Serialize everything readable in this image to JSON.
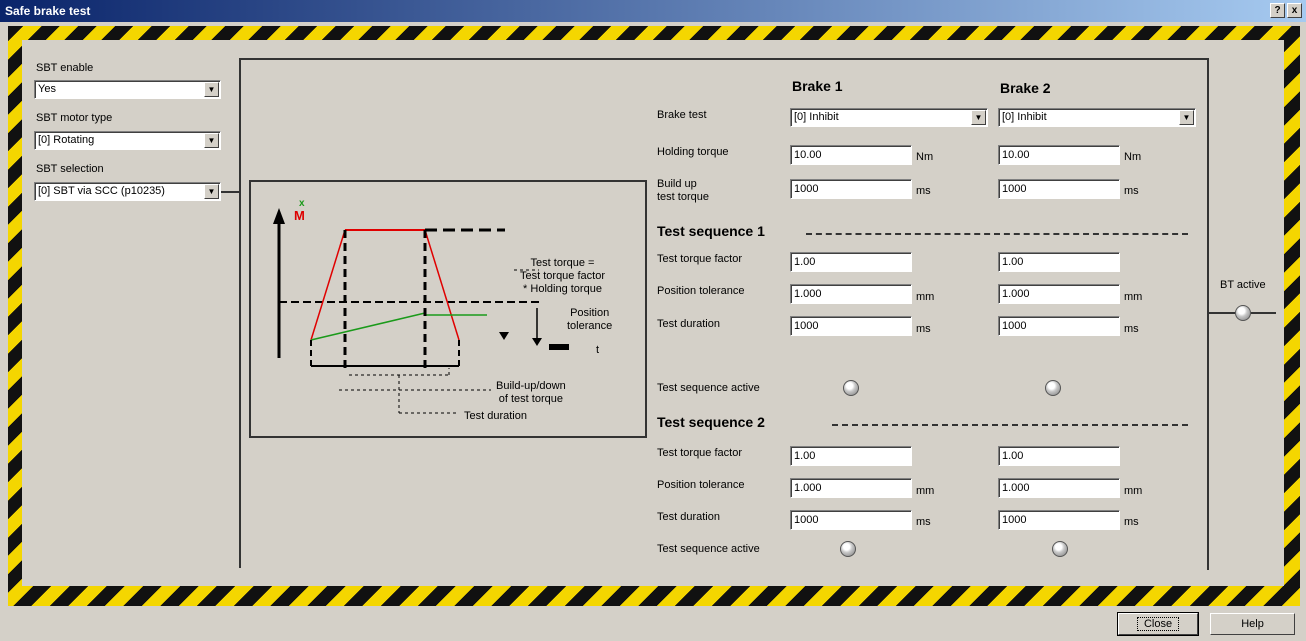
{
  "window": {
    "title": "Safe brake test",
    "help_btn": "?",
    "close_btn": "x"
  },
  "left": {
    "sbt_enable": {
      "label": "SBT enable",
      "value": "Yes"
    },
    "motor_type": {
      "label": "SBT motor type",
      "value": "[0] Rotating"
    },
    "selection": {
      "label": "SBT selection",
      "value": "[0] SBT via SCC (p10235)"
    }
  },
  "diagram": {
    "m_label": "M",
    "x_label": "x",
    "test_torque_text": "Test torque =\nTest torque factor\n* Holding torque",
    "position_tolerance": "Position\ntolerance",
    "t_label": "t",
    "buildup_text": "Build-up/down\nof test torque",
    "test_duration_text": "Test duration"
  },
  "headers": {
    "brake1": "Brake 1",
    "brake2": "Brake 2"
  },
  "rows": {
    "brake_test": {
      "label": "Brake test",
      "b1": "[0] Inhibit",
      "b2": "[0] Inhibit"
    },
    "holding_torque": {
      "label": "Holding torque",
      "b1": "10.00",
      "b2": "10.00",
      "unit": "Nm"
    },
    "build_up": {
      "label": "Build up\ntest torque",
      "b1": "1000",
      "b2": "1000",
      "unit": "ms"
    }
  },
  "seq1": {
    "title": "Test sequence 1",
    "torque_factor": {
      "label": "Test torque factor",
      "b1": "1.00",
      "b2": "1.00"
    },
    "pos_tol": {
      "label": "Position tolerance",
      "b1": "1.000",
      "b2": "1.000",
      "unit": "mm"
    },
    "duration": {
      "label": "Test duration",
      "b1": "1000",
      "b2": "1000",
      "unit": "ms"
    },
    "active_label": "Test sequence active"
  },
  "seq2": {
    "title": "Test sequence 2",
    "torque_factor": {
      "label": "Test torque factor",
      "b1": "1.00",
      "b2": "1.00"
    },
    "pos_tol": {
      "label": "Position tolerance",
      "b1": "1.000",
      "b2": "1.000",
      "unit": "mm"
    },
    "duration": {
      "label": "Test duration",
      "b1": "1000",
      "b2": "1000",
      "unit": "ms"
    },
    "active_label": "Test sequence active"
  },
  "right": {
    "active_label": "BT active"
  },
  "footer": {
    "close": "Close",
    "help": "Help"
  }
}
